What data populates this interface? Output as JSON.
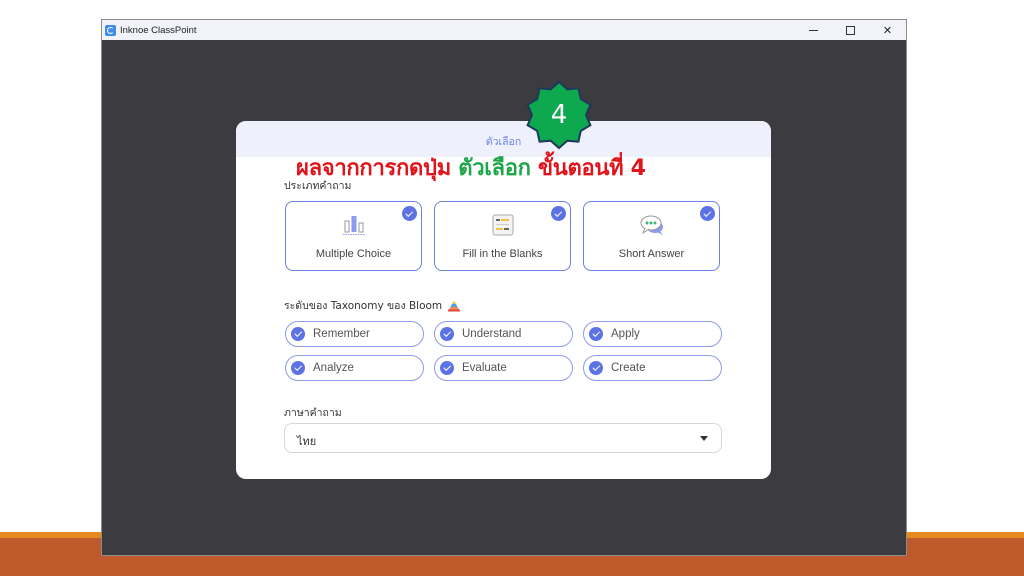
{
  "window": {
    "title": "Inknoe ClassPoint",
    "controls": {
      "minimize": "–",
      "maximize": "☐",
      "close": "✕"
    }
  },
  "dialog": {
    "tab_label": "ตัวเลือก",
    "question_type": {
      "label": "ประเภทคำถาม",
      "cards": [
        {
          "label": "Multiple Choice",
          "icon": "bar-chart-icon",
          "checked": true
        },
        {
          "label": "Fill in the Blanks",
          "icon": "fill-blanks-icon",
          "checked": true
        },
        {
          "label": "Short Answer",
          "icon": "chat-bubble-icon",
          "checked": true
        }
      ]
    },
    "bloom": {
      "label": "ระดับของ Taxonomy ของ Bloom",
      "icon": "pyramid-icon",
      "levels": [
        {
          "label": "Remember",
          "checked": true
        },
        {
          "label": "Understand",
          "checked": true
        },
        {
          "label": "Apply",
          "checked": true
        },
        {
          "label": "Analyze",
          "checked": true
        },
        {
          "label": "Evaluate",
          "checked": true
        },
        {
          "label": "Create",
          "checked": true
        }
      ]
    },
    "language": {
      "label": "ภาษาคำถาม",
      "selected": "ไทย"
    }
  },
  "annotation": {
    "part1": "ผลจากการกดปุ่ม",
    "part2": "ตัวเลือก",
    "part3": "ขั้นตอนที่ 4",
    "badge_number": "4",
    "colors": {
      "red": "#e0141b",
      "green": "#1fa64a",
      "badge": "#0ea84f"
    }
  },
  "colors": {
    "accent": "#5d73e4",
    "window_bg": "#3c3c40",
    "slide_band": "#bf5a2c",
    "slide_stripe": "#e58a1f"
  }
}
